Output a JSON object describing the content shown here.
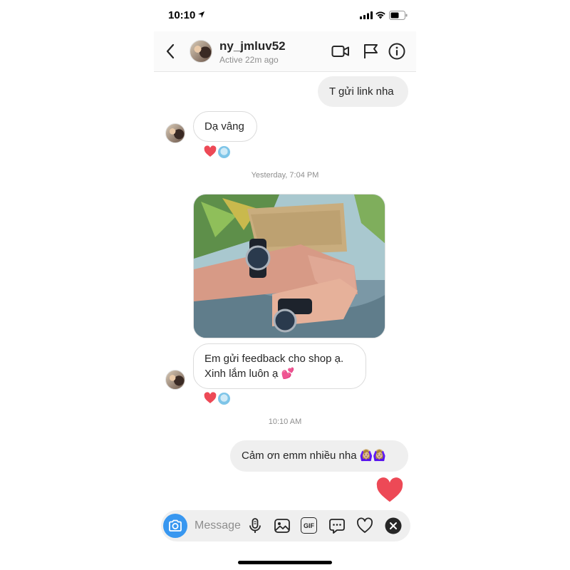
{
  "status_bar": {
    "time": "10:10"
  },
  "header": {
    "username": "ny_jmluv52",
    "active_status": "Active 22m ago"
  },
  "messages": [
    {
      "id": "m1",
      "direction": "outgoing",
      "text": "T gửi link nha"
    },
    {
      "id": "m2",
      "direction": "incoming",
      "text": "Dạ vâng",
      "reactions": [
        "heart",
        "face"
      ]
    },
    {
      "id": "t1",
      "type": "timestamp",
      "text": "Yesterday, 7:04 PM"
    },
    {
      "id": "m3",
      "direction": "incoming",
      "type": "photo",
      "description": "two wrists wearing matching black watches"
    },
    {
      "id": "m4",
      "direction": "incoming",
      "line1": "Em gửi feedback cho shop ạ.",
      "line2": "Xinh lắm luôn ạ 💕",
      "reactions": [
        "heart",
        "face"
      ]
    },
    {
      "id": "t2",
      "type": "timestamp",
      "text": "10:10 AM"
    },
    {
      "id": "m5",
      "direction": "outgoing",
      "text": "Cảm ơn emm nhiều nha 🙆🏼‍♀️🙆🏼‍♀️"
    },
    {
      "id": "m6",
      "direction": "outgoing",
      "type": "like",
      "emoji": "heart"
    }
  ],
  "composer": {
    "placeholder": "Message",
    "gif_label": "GIF"
  },
  "colors": {
    "accent": "#3897f0",
    "heart": "#ed4956",
    "outgoing_bubble": "#efefef",
    "muted_text": "#8e8e8e"
  }
}
